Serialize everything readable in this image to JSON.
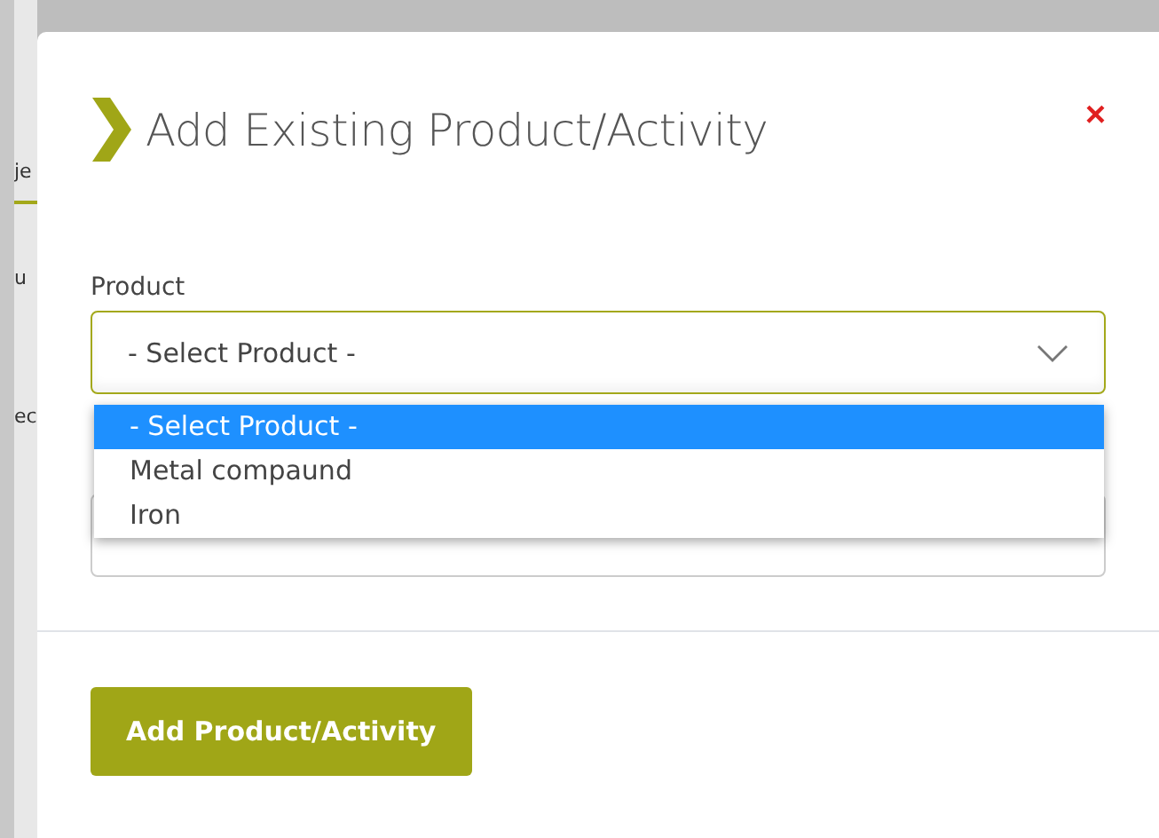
{
  "background_fragments": [
    "je",
    "u",
    "ec"
  ],
  "dialog": {
    "title": "Add Existing Product/Activity",
    "close": "×"
  },
  "product_field": {
    "label": "Product",
    "value": "- Select Product -",
    "expanded": true,
    "options": [
      {
        "label": "- Select Product -",
        "selected": true
      },
      {
        "label": "Metal compaund",
        "selected": false
      },
      {
        "label": "Iron",
        "selected": false
      }
    ]
  },
  "buttons": [
    {
      "label": "Add Product/Activity"
    }
  ]
}
